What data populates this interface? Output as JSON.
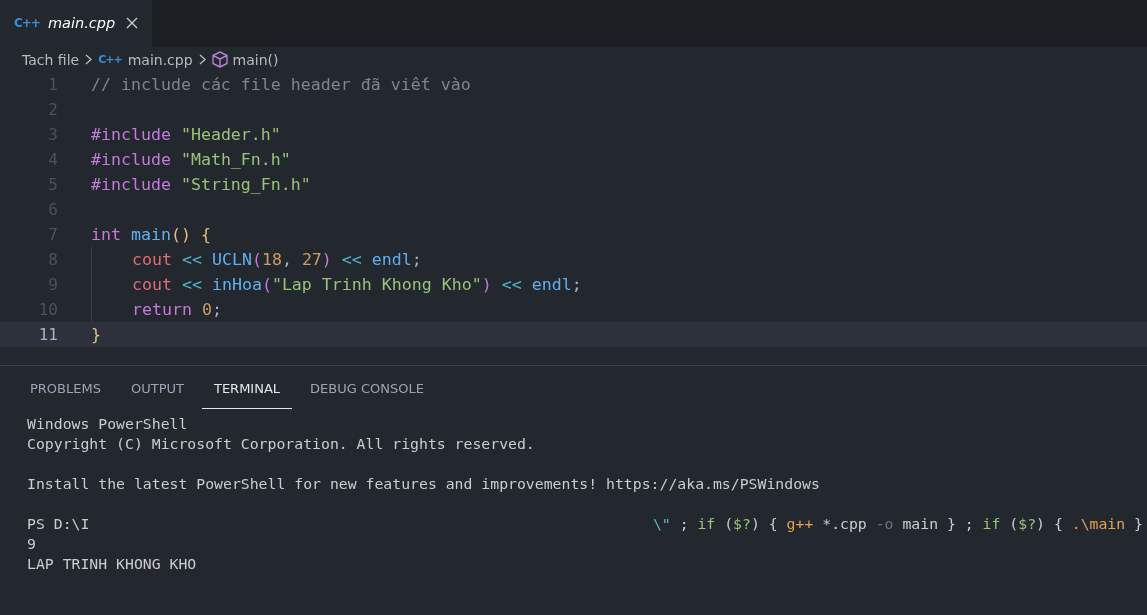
{
  "tabs": [
    {
      "label": "main.cpp",
      "icon": "C++",
      "selected": true
    }
  ],
  "breadcrumb": [
    {
      "label": "Tach file",
      "kind": "folder"
    },
    {
      "label": "main.cpp",
      "kind": "file",
      "icon": "C++"
    },
    {
      "label": "main()",
      "kind": "symbol"
    }
  ],
  "code_lines": [
    {
      "number": "1",
      "current": false,
      "indented": false,
      "tokens": [
        {
          "text": "// include các file header đã viết vào",
          "kind": "comment"
        }
      ]
    },
    {
      "number": "2",
      "current": false,
      "indented": false
    },
    {
      "number": "3",
      "current": false,
      "indented": false,
      "tokens": [
        {
          "text": "#include ",
          "kind": "keyword"
        },
        {
          "text": "\"Header.h\"",
          "kind": "string"
        }
      ]
    },
    {
      "number": "4",
      "current": false,
      "indented": false,
      "tokens": [
        {
          "text": "#include ",
          "kind": "keyword"
        },
        {
          "text": "\"Math_Fn.h\"",
          "kind": "string"
        }
      ]
    },
    {
      "number": "5",
      "current": false,
      "indented": false,
      "tokens": [
        {
          "text": "#include ",
          "kind": "keyword"
        },
        {
          "text": "\"String_Fn.h\"",
          "kind": "string"
        }
      ]
    },
    {
      "number": "6",
      "current": false,
      "indented": false
    },
    {
      "number": "7",
      "current": false,
      "indented": false,
      "tokens": [
        {
          "text": "int ",
          "kind": "keyword"
        },
        {
          "text": "main",
          "kind": "function"
        },
        {
          "text": "() {",
          "kind": "bracket"
        }
      ]
    },
    {
      "number": "8",
      "current": false,
      "indented": true,
      "tokens": [
        {
          "text": "cout ",
          "kind": "variable"
        },
        {
          "text": "<< ",
          "kind": "operator"
        },
        {
          "text": "UCLN",
          "kind": "function"
        },
        {
          "text": "(",
          "kind": "paren"
        },
        {
          "text": "18",
          "kind": "number"
        },
        {
          "text": ", ",
          "kind": "plain"
        },
        {
          "text": "27",
          "kind": "number"
        },
        {
          "text": ") ",
          "kind": "paren"
        },
        {
          "text": "<< ",
          "kind": "operator"
        },
        {
          "text": "endl",
          "kind": "function"
        },
        {
          "text": ";",
          "kind": "plain"
        }
      ]
    },
    {
      "number": "9",
      "current": false,
      "indented": true,
      "tokens": [
        {
          "text": "cout ",
          "kind": "variable"
        },
        {
          "text": "<< ",
          "kind": "operator"
        },
        {
          "text": "inHoa",
          "kind": "function"
        },
        {
          "text": "(",
          "kind": "paren"
        },
        {
          "text": "\"Lap Trinh Khong Kho\"",
          "kind": "string"
        },
        {
          "text": ") ",
          "kind": "paren"
        },
        {
          "text": "<< ",
          "kind": "operator"
        },
        {
          "text": "endl",
          "kind": "function"
        },
        {
          "text": ";",
          "kind": "plain"
        }
      ]
    },
    {
      "number": "10",
      "current": false,
      "indented": true,
      "tokens": [
        {
          "text": "return ",
          "kind": "keyword"
        },
        {
          "text": "0",
          "kind": "number"
        },
        {
          "text": ";",
          "kind": "plain"
        }
      ]
    },
    {
      "number": "11",
      "current": true,
      "indented": false,
      "tokens": [
        {
          "text": "}",
          "kind": "bracket"
        }
      ]
    }
  ],
  "panel_tabs": [
    {
      "label": "PROBLEMS",
      "selected": false
    },
    {
      "label": "OUTPUT",
      "selected": false
    },
    {
      "label": "TERMINAL",
      "selected": true
    },
    {
      "label": "DEBUG CONSOLE",
      "selected": false
    }
  ],
  "terminal_lines": [
    {
      "kind": "text",
      "text": "Windows PowerShell"
    },
    {
      "kind": "text",
      "text": "Copyright (C) Microsoft Corporation. All rights reserved."
    },
    {
      "kind": "blank"
    },
    {
      "kind": "text",
      "text": "Install the latest PowerShell for new features and improvements! https://aka.ms/PSWindows"
    },
    {
      "kind": "blank"
    },
    {
      "kind": "prompt",
      "text": "PS D:\\I",
      "tokens": [
        {
          "text": "\\\"",
          "kind": "escape"
        },
        {
          "text": " ; ",
          "kind": "plain"
        },
        {
          "text": "if",
          "kind": "keyword"
        },
        {
          "text": " (",
          "kind": "plain"
        },
        {
          "text": "$?",
          "kind": "keyword"
        },
        {
          "text": ") { ",
          "kind": "plain"
        },
        {
          "text": "g++",
          "kind": "command"
        },
        {
          "text": " *.cpp ",
          "kind": "plain"
        },
        {
          "text": "-o",
          "kind": "flag"
        },
        {
          "text": " main } ; ",
          "kind": "plain"
        },
        {
          "text": "if",
          "kind": "keyword"
        },
        {
          "text": " (",
          "kind": "plain"
        },
        {
          "text": "$?",
          "kind": "keyword"
        },
        {
          "text": ") { ",
          "kind": "plain"
        },
        {
          "text": ".\\main",
          "kind": "command"
        },
        {
          "text": " }",
          "kind": "plain"
        }
      ]
    },
    {
      "kind": "text",
      "text": "9"
    },
    {
      "kind": "text",
      "text": "LAP TRINH KHONG KHO"
    }
  ]
}
